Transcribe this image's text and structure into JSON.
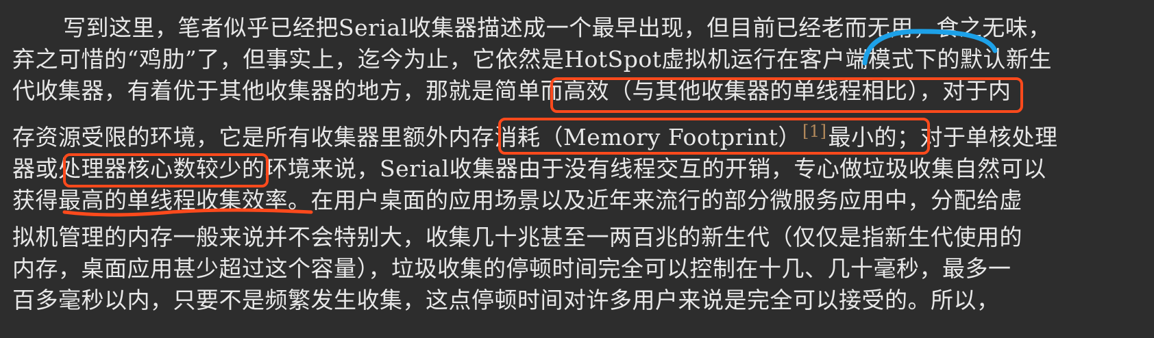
{
  "lines": [
    "写到这里，笔者似乎已经把Serial收集器描述成一个最早出现，但目前已经老而无用，食之无味，",
    "弃之可惜的“鸡肋”了，但事实上，迄今为止，它依然是HotSpot虚拟机运行在客户端模式下的默认新生",
    "代收集器，有着优于其他收集器的地方，那就是简单而高效（与其他收集器的单线程相比），对于内",
    "存资源受限的环境，它是所有收集器里额外内存消耗（Memory Footprint）",
    "器或处理器核心数较少的环境来说，Serial收集器由于没有线程交互的开销，专心做垃圾收集自然可以",
    "获得最高的单线程收集效率。在用户桌面的应用场景以及近年来流行的部分微服务应用中，分配给虚",
    "拟机管理的内存一般来说并不会特别大，收集几十兆甚至一两百兆的新生代（仅仅是指新生代使用的",
    "内存，桌面应用甚少超过这个容量），垃圾收集的停顿时间完全可以控制在十几、几十毫秒，最多一",
    "百多毫秒以内，只要不是频繁发生收集，这点停顿时间对许多用户来说是完全可以接受的。所以，"
  ],
  "line4_footnote": "[1]",
  "line4_tail": "最小的；对于单核处理",
  "colors": {
    "background": "#2d2d2d",
    "text": "#e8e8e8",
    "footnote": "#b38a5c",
    "highlight_box": "#ff4a1c",
    "underline_red": "#ff4a1c",
    "mark_blue": "#1da1e8"
  }
}
